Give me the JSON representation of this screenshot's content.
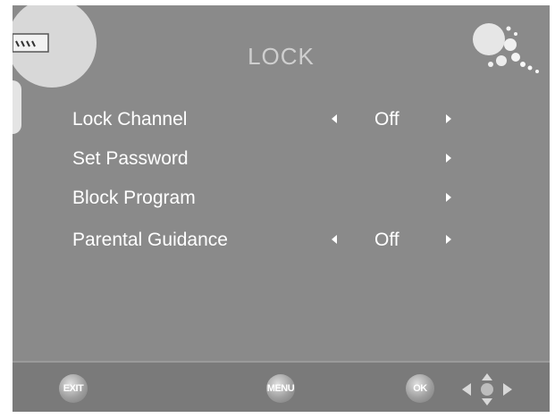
{
  "title": "LOCK",
  "menu": [
    {
      "label": "Lock  Channel",
      "value": "Off",
      "has_left": true
    },
    {
      "label": "Set Password",
      "value": "",
      "has_left": false
    },
    {
      "label": "Block Program",
      "value": "",
      "has_left": false
    },
    {
      "label": "Parental Guidance",
      "value": "Off",
      "has_left": true
    }
  ],
  "footer": {
    "exit": "EXIT",
    "menu": "MENU",
    "ok": "OK"
  },
  "colors": {
    "background": "#8a8a8a",
    "text": "#ffffff",
    "title": "#cfcfcf",
    "footer": "#7a7a7a"
  },
  "icons": [
    "lock-logo-icon",
    "bubbles-decoration-icon",
    "dpad-icon"
  ]
}
